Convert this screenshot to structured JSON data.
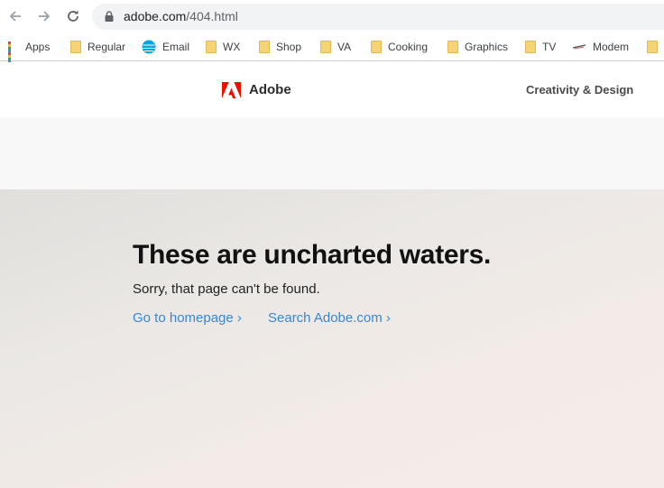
{
  "browser": {
    "url_host": "adobe.com",
    "url_path": "/404.html"
  },
  "bookmarks": [
    {
      "label": "Apps",
      "icon": "apps-grid-icon"
    },
    {
      "label": "Regular",
      "icon": "folder-icon"
    },
    {
      "label": "Email",
      "icon": "att-globe-icon"
    },
    {
      "label": "WX",
      "icon": "folder-icon"
    },
    {
      "label": "Shop",
      "icon": "folder-icon"
    },
    {
      "label": "VA",
      "icon": "folder-icon"
    },
    {
      "label": "Cooking",
      "icon": "folder-icon"
    },
    {
      "label": "Graphics",
      "icon": "folder-icon"
    },
    {
      "label": "TV",
      "icon": "folder-icon"
    },
    {
      "label": "Modem",
      "icon": "modem-icon"
    }
  ],
  "header": {
    "brand": "Adobe",
    "nav_link": "Creativity & Design"
  },
  "error": {
    "headline": "These are uncharted waters.",
    "message": "Sorry, that page can't be found.",
    "link_home": "Go to homepage ›",
    "link_search": "Search Adobe.com ›"
  },
  "colors": {
    "adobe_red": "#eb1000",
    "link_blue": "#3a86cf",
    "folder_yellow": "#f6d476"
  }
}
